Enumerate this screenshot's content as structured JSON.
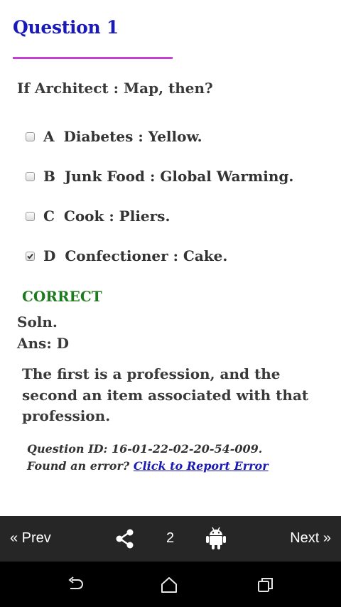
{
  "question": {
    "title": "Question 1",
    "text": "If Architect : Map, then?",
    "options": [
      {
        "letter": "A",
        "text": "Diabetes : Yellow.",
        "checked": false
      },
      {
        "letter": "B",
        "text": "Junk Food : Global Warming.",
        "checked": false
      },
      {
        "letter": "C",
        "text": "Cook : Pliers.",
        "checked": false
      },
      {
        "letter": "D",
        "text": "Confectioner : Cake.",
        "checked": true
      }
    ]
  },
  "result": {
    "status": "CORRECT",
    "status_color": "#1f7a1f"
  },
  "solution": {
    "label": "Soln.",
    "answer": "Ans: D",
    "explanation": "The first is a profession, and the second an item associated with that profession."
  },
  "meta": {
    "question_id": "Question ID: 16-01-22-02-20-54-009.",
    "error_prompt": "Found an error?",
    "report_link": "Click to Report Error"
  },
  "bottom_bar": {
    "prev_label": "« Prev",
    "page_number": "2",
    "next_label": "Next »",
    "share_icon": "share-icon",
    "android_icon": "android-icon"
  },
  "nav_bar": {
    "back_icon": "back-icon",
    "home_icon": "home-icon",
    "recent_icon": "recent-apps-icon"
  },
  "colors": {
    "title": "#1a1ab8",
    "underline": "#c43fd6",
    "link": "#1a1ab8",
    "bottom_bar_bg": "#262626",
    "nav_bar_bg": "#000000"
  }
}
